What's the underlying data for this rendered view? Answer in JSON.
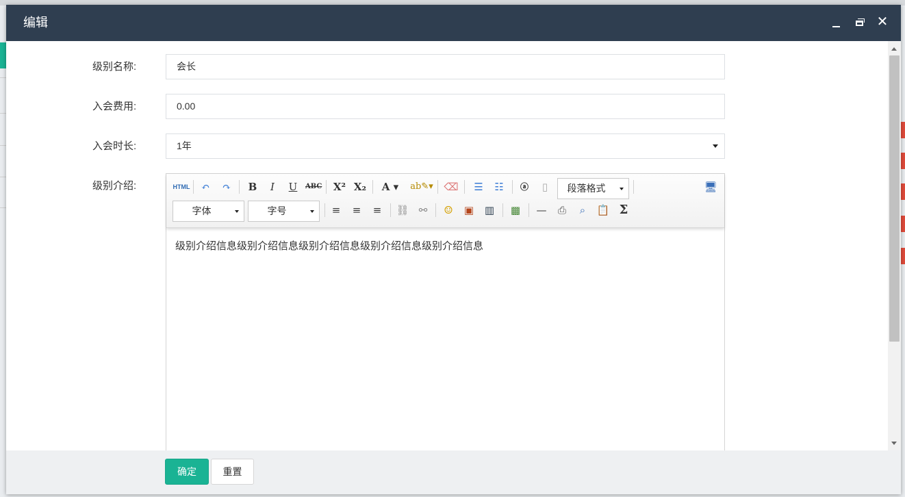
{
  "modal": {
    "title": "编辑",
    "minimize_icon": "minimize-icon",
    "maximize_icon": "maximize-icon",
    "close_icon": "close-icon"
  },
  "form": {
    "level_name": {
      "label": "级别名称:",
      "value": "会长"
    },
    "join_fee": {
      "label": "入会费用:",
      "value": "0.00"
    },
    "duration": {
      "label": "入会时长:",
      "selected": "1年"
    },
    "intro": {
      "label": "级别介绍:"
    }
  },
  "editor": {
    "toolbar": {
      "html_label": "HTML",
      "paragraph_format": "段落格式",
      "font_family": "字体",
      "font_size": "字号",
      "sigma": "Σ",
      "buttons": [
        "html",
        "undo",
        "redo",
        "bold",
        "italic",
        "underline",
        "strikethrough",
        "superscript",
        "subscript",
        "font-color",
        "highlight-color",
        "eraser",
        "ordered-list",
        "unordered-list",
        "anchor",
        "page",
        "paragraph-format",
        "fullscreen",
        "font-family",
        "font-size",
        "align-left",
        "align-center",
        "align-right",
        "link",
        "unlink",
        "emoji",
        "image",
        "video",
        "image-map",
        "horizontal-rule",
        "print",
        "preview",
        "paste",
        "formula"
      ]
    },
    "content": "级别介绍信息级别介绍信息级别介绍信息级别介绍信息级别介绍信息"
  },
  "footer": {
    "confirm_label": "确定",
    "reset_label": "重置"
  },
  "colors": {
    "header_bg": "#2f3e50",
    "primary": "#1ab394"
  }
}
